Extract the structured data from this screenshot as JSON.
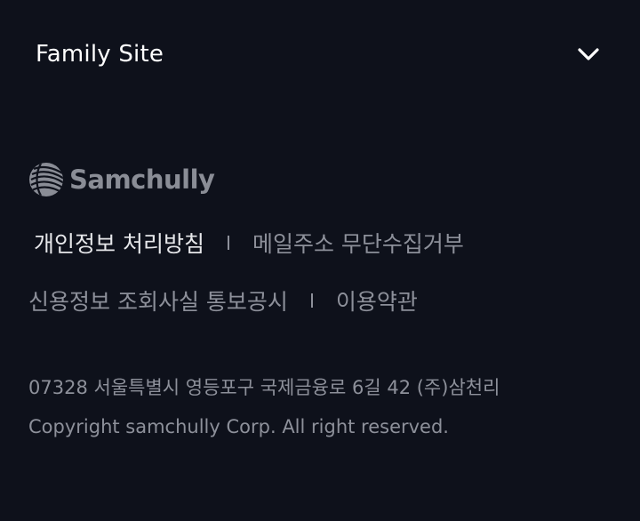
{
  "family_site": {
    "label": "Family Site",
    "icon": "chevron-down-icon"
  },
  "logo": {
    "text": "Samchully",
    "icon": "samchully-logo-mark"
  },
  "links": {
    "privacy_policy": "개인정보 처리방침",
    "email_refusal": "메일주소 무단수집거부",
    "credit_notice": "신용정보 조회사실 통보공시",
    "terms": "이용약관"
  },
  "address": "07328 서울특별시 영등포구 국제금융로 6길 42 (주)삼천리",
  "copyright": "Copyright samchully Corp. All right reserved.",
  "colors": {
    "background": "#0e111b",
    "primary_text": "#ffffff",
    "secondary_text": "#8d909a"
  }
}
